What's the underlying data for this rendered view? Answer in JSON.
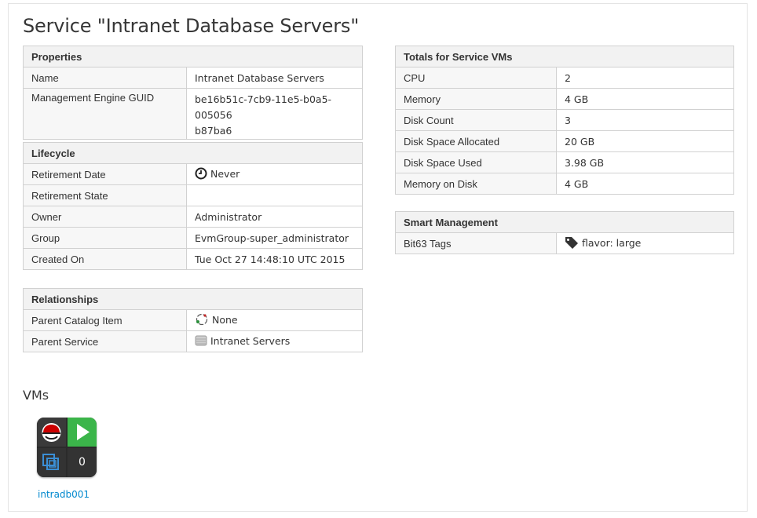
{
  "page": {
    "title": "Service \"Intranet Database Servers\""
  },
  "properties": {
    "header": "Properties",
    "rows": [
      {
        "label": "Name",
        "value": "Intranet Database Servers"
      },
      {
        "label": "Management Engine GUID",
        "value": "be16b51c-7cb9-11e5-b0a5-005056",
        "value2": "b87ba6"
      }
    ]
  },
  "lifecycle": {
    "header": "Lifecycle",
    "rows": [
      {
        "label": "Retirement Date",
        "value": "Never",
        "icon": "clock-icon"
      },
      {
        "label": "Retirement State",
        "value": ""
      },
      {
        "label": "Owner",
        "value": "Administrator"
      },
      {
        "label": "Group",
        "value": "EvmGroup-super_administrator"
      },
      {
        "label": "Created On",
        "value": "Tue Oct 27 14:48:10 UTC 2015"
      }
    ]
  },
  "relationships": {
    "header": "Relationships",
    "rows": [
      {
        "label": "Parent Catalog Item",
        "value": "None",
        "icon": "catalog-item-icon"
      },
      {
        "label": "Parent Service",
        "value": "Intranet Servers",
        "icon": "service-icon"
      }
    ]
  },
  "totals": {
    "header": "Totals for Service VMs",
    "rows": [
      {
        "label": "CPU",
        "value": "2"
      },
      {
        "label": "Memory",
        "value": "4 GB"
      },
      {
        "label": "Disk Count",
        "value": "3"
      },
      {
        "label": "Disk Space Allocated",
        "value": "20 GB"
      },
      {
        "label": "Disk Space Used",
        "value": "3.98 GB"
      },
      {
        "label": "Memory on Disk",
        "value": "4 GB"
      }
    ]
  },
  "smart": {
    "header": "Smart Management",
    "rows": [
      {
        "label": "Bit63 Tags",
        "value": "flavor: large",
        "icon": "tag-icon"
      }
    ]
  },
  "vms": {
    "title": "VMs",
    "items": [
      {
        "name": "intradb001",
        "os_icon": "redhat-icon",
        "state_icon": "play-icon",
        "vendor_icon": "vmware-icon",
        "snapshots": "0",
        "state_color": "#3bb54a"
      }
    ]
  }
}
